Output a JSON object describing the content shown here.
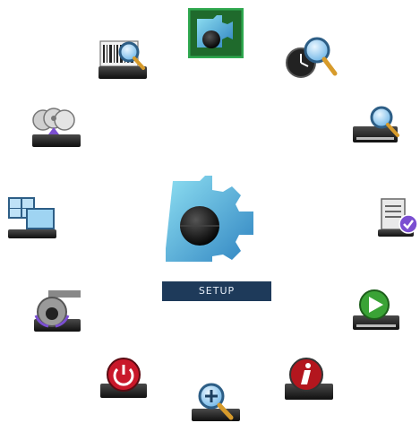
{
  "menu": {
    "selected": "setup",
    "selected_label": "SETUP",
    "items": [
      {
        "id": "setup",
        "icon": "gear-icon"
      },
      {
        "id": "time-search",
        "icon": "clock-search-icon"
      },
      {
        "id": "dvr-search",
        "icon": "hdd-search-icon"
      },
      {
        "id": "event-log",
        "icon": "log-check-icon"
      },
      {
        "id": "playback",
        "icon": "play-icon"
      },
      {
        "id": "info",
        "icon": "info-icon"
      },
      {
        "id": "zoom",
        "icon": "zoom-icon"
      },
      {
        "id": "shutdown",
        "icon": "power-icon"
      },
      {
        "id": "ptz",
        "icon": "ptz-camera-icon"
      },
      {
        "id": "display",
        "icon": "multi-monitor-icon"
      },
      {
        "id": "backup",
        "icon": "disc-backup-icon"
      },
      {
        "id": "archive-search",
        "icon": "barcode-search-icon"
      }
    ]
  },
  "colors": {
    "accent_frame": "#2fa84f",
    "gear_light": "#7fd3ea",
    "gear_dark": "#2f87c2",
    "label_bg": "#1e3a5a",
    "label_text": "#e6eef8",
    "power_red": "#c9182a",
    "info_red": "#b3161e",
    "play_green": "#3aa336",
    "check_purple": "#7b4fd1"
  }
}
